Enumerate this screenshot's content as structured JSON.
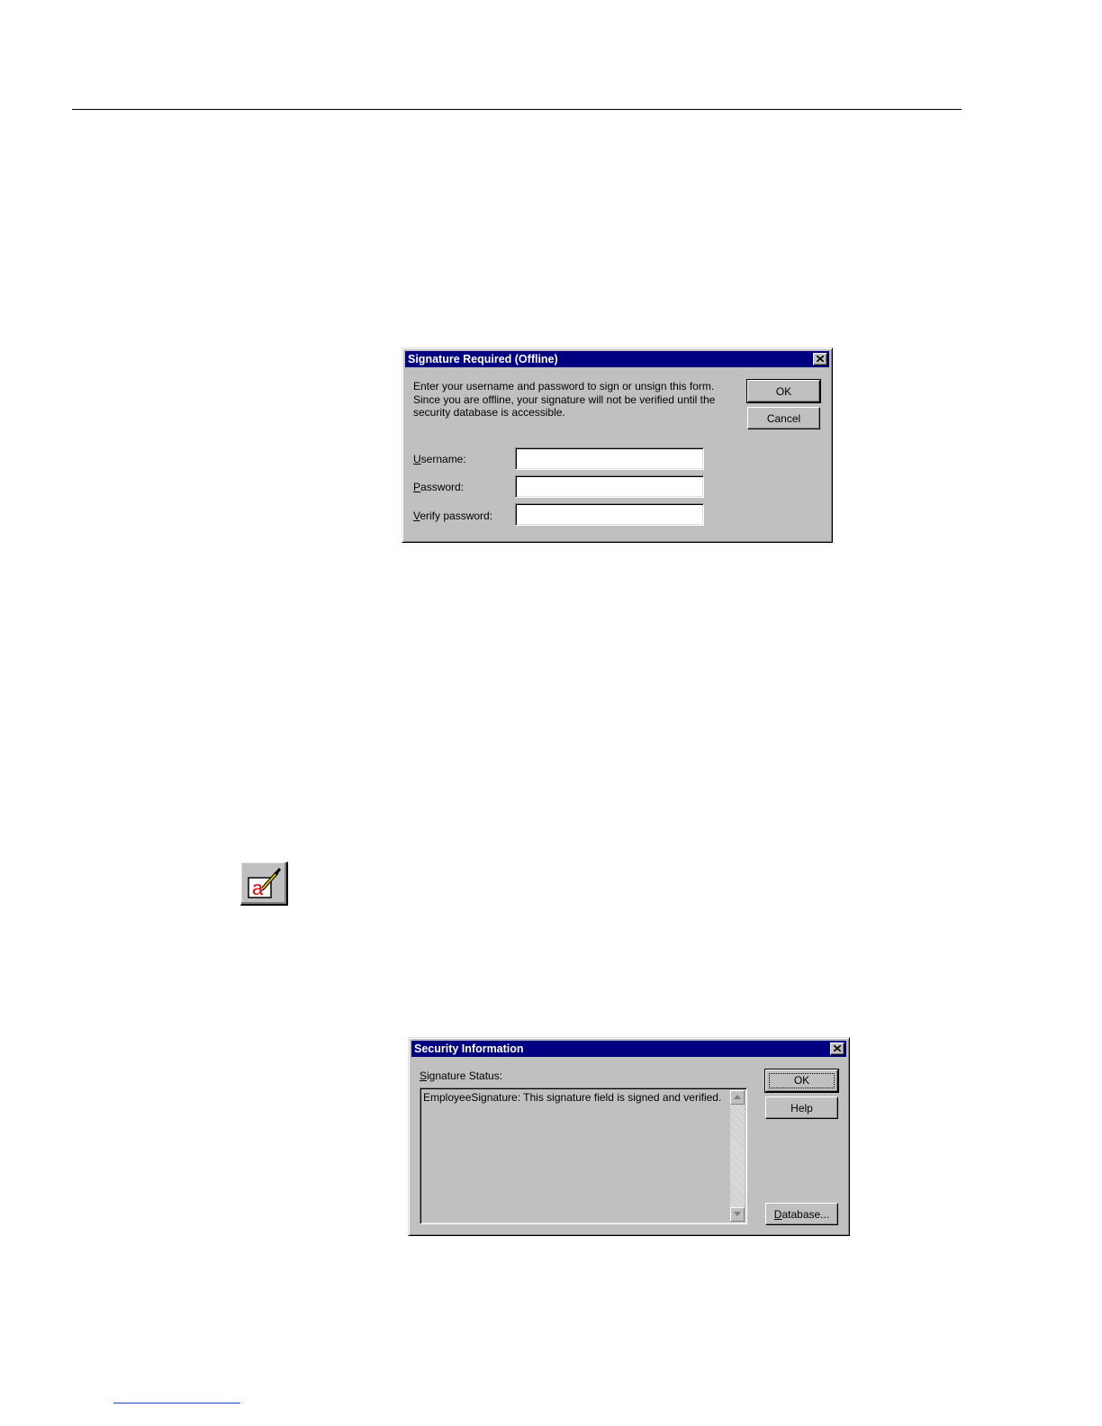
{
  "signature_dialog": {
    "title": "Signature Required (Offline)",
    "message": "Enter your username and password to sign or unsign this form. Since you are offline, your signature will not be verified until the security database is accessible.",
    "ok_label": "OK",
    "cancel_label": "Cancel",
    "username_label": "Username:",
    "password_label": "Password:",
    "verify_label": "Verify password:",
    "username_value": "",
    "password_value": "",
    "verify_value": ""
  },
  "security_dialog": {
    "title": "Security Information",
    "status_label": "Signature Status:",
    "status_text": "EmployeeSignature: This signature field is signed and verified.",
    "ok_label": "OK",
    "help_label": "Help",
    "database_label": "Database..."
  },
  "icons": {
    "sign_button": "sign-form-icon",
    "close": "close-icon"
  },
  "colors": {
    "titlebar": "#000080",
    "dialog_face": "#c0c0c0"
  }
}
